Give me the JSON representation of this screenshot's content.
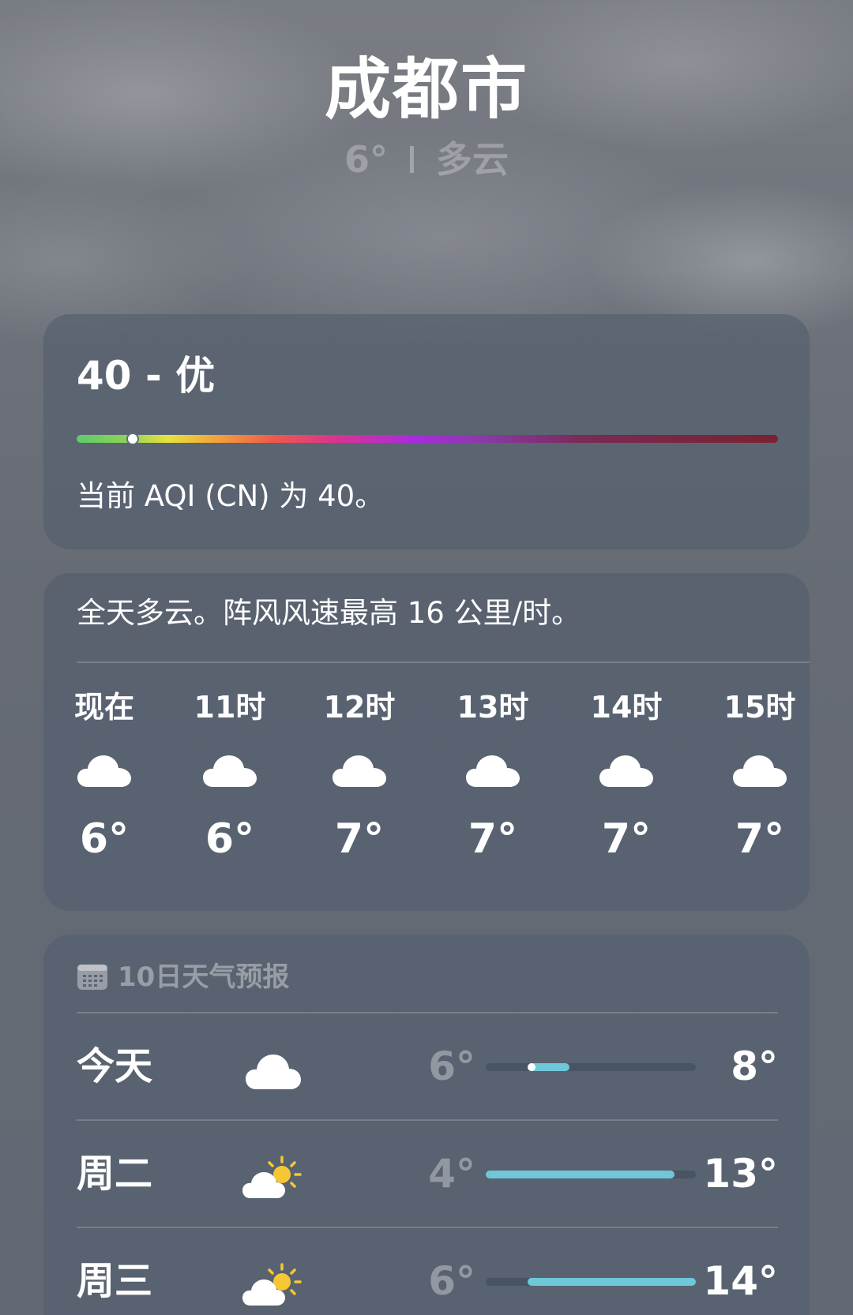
{
  "header": {
    "city": "成都市",
    "current_temp": "6°",
    "condition": "多云"
  },
  "aqi": {
    "value_label": "40 - 优",
    "value": 40,
    "scale_max": 500,
    "description": "当前 AQI (CN) 为 40。"
  },
  "hourly": {
    "summary": "全天多云。阵风风速最高 16 公里/时。",
    "hours": [
      {
        "label": "现在",
        "icon": "cloud-icon",
        "temp": "6°"
      },
      {
        "label": "11时",
        "icon": "cloud-icon",
        "temp": "6°"
      },
      {
        "label": "12时",
        "icon": "cloud-icon",
        "temp": "7°"
      },
      {
        "label": "13时",
        "icon": "cloud-icon",
        "temp": "7°"
      },
      {
        "label": "14时",
        "icon": "cloud-icon",
        "temp": "7°"
      },
      {
        "label": "15时",
        "icon": "cloud-icon",
        "temp": "7°"
      }
    ]
  },
  "daily": {
    "title": "10日天气预报",
    "range_min": 4,
    "range_max": 14,
    "days": [
      {
        "name": "今天",
        "icon": "cloud-icon",
        "low": "6°",
        "high": "8°",
        "low_value": 6,
        "high_value": 8,
        "current_value": 6
      },
      {
        "name": "周二",
        "icon": "partly-sunny-icon",
        "low": "4°",
        "high": "13°",
        "low_value": 4,
        "high_value": 13
      },
      {
        "name": "周三",
        "icon": "partly-sunny-icon",
        "low": "6°",
        "high": "14°",
        "low_value": 6,
        "high_value": 14
      }
    ]
  },
  "colors": {
    "range_fill": "#6fc7da",
    "card_background": "#525e6e"
  }
}
